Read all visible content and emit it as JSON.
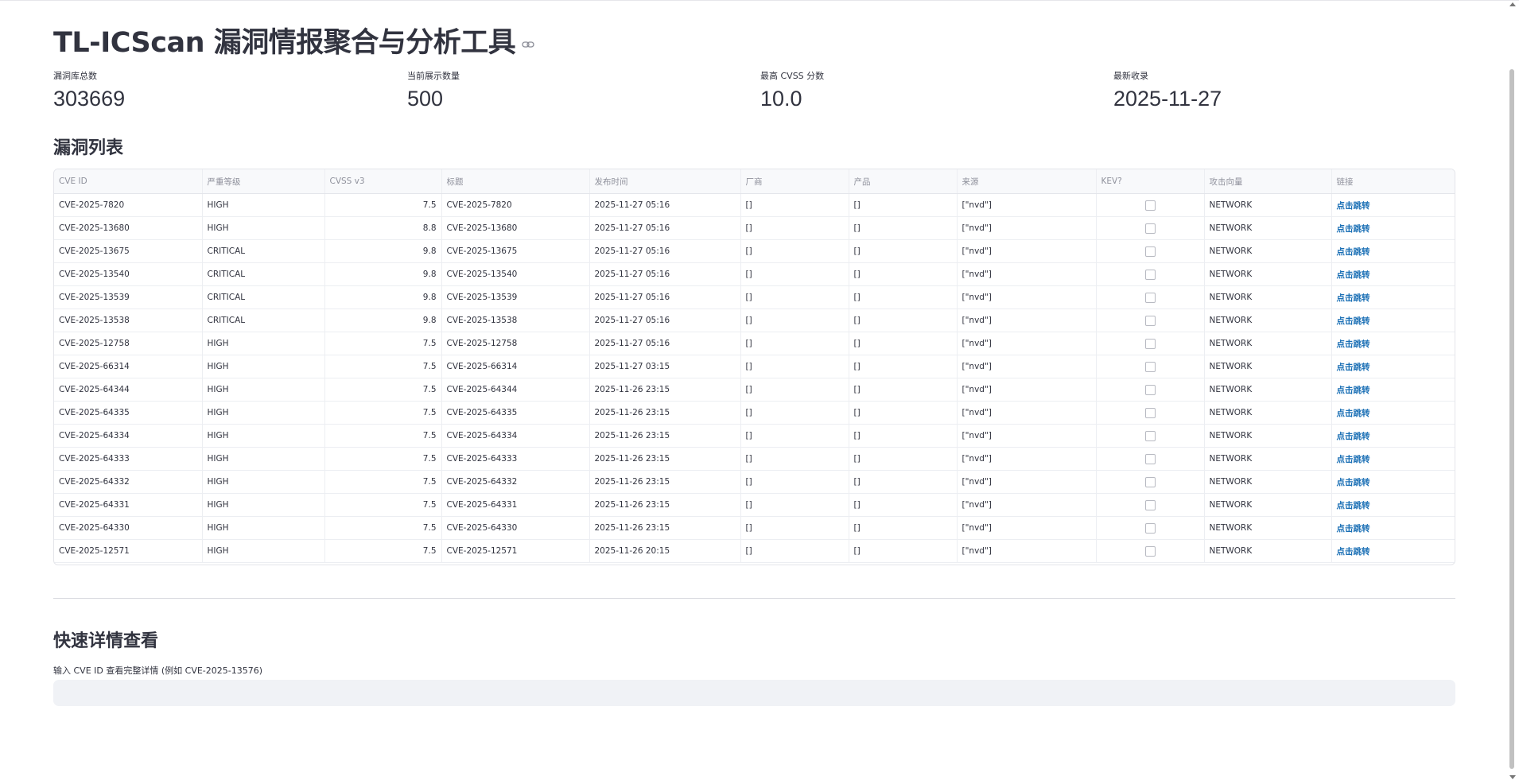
{
  "page": {
    "title": "TL-ICScan 漏洞情报聚合与分析工具"
  },
  "metrics": [
    {
      "label": "漏洞库总数",
      "value": "303669"
    },
    {
      "label": "当前展示数量",
      "value": "500"
    },
    {
      "label": "最高 CVSS 分数",
      "value": "10.0"
    },
    {
      "label": "最新收录",
      "value": "2025-11-27"
    }
  ],
  "vuln_section": {
    "heading": "漏洞列表"
  },
  "table": {
    "columns": [
      "CVE ID",
      "严重等级",
      "CVSS v3",
      "标题",
      "发布时间",
      "厂商",
      "产品",
      "来源",
      "KEV?",
      "攻击向量",
      "链接"
    ],
    "rows": [
      {
        "cve": "CVE-2025-7820",
        "severity": "HIGH",
        "cvss": "7.5",
        "title": "CVE-2025-7820",
        "published": "2025-11-27 05:16",
        "vendor": "[]",
        "product": "[]",
        "source": "[\"nvd\"]",
        "kev": false,
        "vector": "NETWORK",
        "link": "点击跳转"
      },
      {
        "cve": "CVE-2025-13680",
        "severity": "HIGH",
        "cvss": "8.8",
        "title": "CVE-2025-13680",
        "published": "2025-11-27 05:16",
        "vendor": "[]",
        "product": "[]",
        "source": "[\"nvd\"]",
        "kev": false,
        "vector": "NETWORK",
        "link": "点击跳转"
      },
      {
        "cve": "CVE-2025-13675",
        "severity": "CRITICAL",
        "cvss": "9.8",
        "title": "CVE-2025-13675",
        "published": "2025-11-27 05:16",
        "vendor": "[]",
        "product": "[]",
        "source": "[\"nvd\"]",
        "kev": false,
        "vector": "NETWORK",
        "link": "点击跳转"
      },
      {
        "cve": "CVE-2025-13540",
        "severity": "CRITICAL",
        "cvss": "9.8",
        "title": "CVE-2025-13540",
        "published": "2025-11-27 05:16",
        "vendor": "[]",
        "product": "[]",
        "source": "[\"nvd\"]",
        "kev": false,
        "vector": "NETWORK",
        "link": "点击跳转"
      },
      {
        "cve": "CVE-2025-13539",
        "severity": "CRITICAL",
        "cvss": "9.8",
        "title": "CVE-2025-13539",
        "published": "2025-11-27 05:16",
        "vendor": "[]",
        "product": "[]",
        "source": "[\"nvd\"]",
        "kev": false,
        "vector": "NETWORK",
        "link": "点击跳转"
      },
      {
        "cve": "CVE-2025-13538",
        "severity": "CRITICAL",
        "cvss": "9.8",
        "title": "CVE-2025-13538",
        "published": "2025-11-27 05:16",
        "vendor": "[]",
        "product": "[]",
        "source": "[\"nvd\"]",
        "kev": false,
        "vector": "NETWORK",
        "link": "点击跳转"
      },
      {
        "cve": "CVE-2025-12758",
        "severity": "HIGH",
        "cvss": "7.5",
        "title": "CVE-2025-12758",
        "published": "2025-11-27 05:16",
        "vendor": "[]",
        "product": "[]",
        "source": "[\"nvd\"]",
        "kev": false,
        "vector": "NETWORK",
        "link": "点击跳转"
      },
      {
        "cve": "CVE-2025-66314",
        "severity": "HIGH",
        "cvss": "7.5",
        "title": "CVE-2025-66314",
        "published": "2025-11-27 03:15",
        "vendor": "[]",
        "product": "[]",
        "source": "[\"nvd\"]",
        "kev": false,
        "vector": "NETWORK",
        "link": "点击跳转"
      },
      {
        "cve": "CVE-2025-64344",
        "severity": "HIGH",
        "cvss": "7.5",
        "title": "CVE-2025-64344",
        "published": "2025-11-26 23:15",
        "vendor": "[]",
        "product": "[]",
        "source": "[\"nvd\"]",
        "kev": false,
        "vector": "NETWORK",
        "link": "点击跳转"
      },
      {
        "cve": "CVE-2025-64335",
        "severity": "HIGH",
        "cvss": "7.5",
        "title": "CVE-2025-64335",
        "published": "2025-11-26 23:15",
        "vendor": "[]",
        "product": "[]",
        "source": "[\"nvd\"]",
        "kev": false,
        "vector": "NETWORK",
        "link": "点击跳转"
      },
      {
        "cve": "CVE-2025-64334",
        "severity": "HIGH",
        "cvss": "7.5",
        "title": "CVE-2025-64334",
        "published": "2025-11-26 23:15",
        "vendor": "[]",
        "product": "[]",
        "source": "[\"nvd\"]",
        "kev": false,
        "vector": "NETWORK",
        "link": "点击跳转"
      },
      {
        "cve": "CVE-2025-64333",
        "severity": "HIGH",
        "cvss": "7.5",
        "title": "CVE-2025-64333",
        "published": "2025-11-26 23:15",
        "vendor": "[]",
        "product": "[]",
        "source": "[\"nvd\"]",
        "kev": false,
        "vector": "NETWORK",
        "link": "点击跳转"
      },
      {
        "cve": "CVE-2025-64332",
        "severity": "HIGH",
        "cvss": "7.5",
        "title": "CVE-2025-64332",
        "published": "2025-11-26 23:15",
        "vendor": "[]",
        "product": "[]",
        "source": "[\"nvd\"]",
        "kev": false,
        "vector": "NETWORK",
        "link": "点击跳转"
      },
      {
        "cve": "CVE-2025-64331",
        "severity": "HIGH",
        "cvss": "7.5",
        "title": "CVE-2025-64331",
        "published": "2025-11-26 23:15",
        "vendor": "[]",
        "product": "[]",
        "source": "[\"nvd\"]",
        "kev": false,
        "vector": "NETWORK",
        "link": "点击跳转"
      },
      {
        "cve": "CVE-2025-64330",
        "severity": "HIGH",
        "cvss": "7.5",
        "title": "CVE-2025-64330",
        "published": "2025-11-26 23:15",
        "vendor": "[]",
        "product": "[]",
        "source": "[\"nvd\"]",
        "kev": false,
        "vector": "NETWORK",
        "link": "点击跳转"
      },
      {
        "cve": "CVE-2025-12571",
        "severity": "HIGH",
        "cvss": "7.5",
        "title": "CVE-2025-12571",
        "published": "2025-11-26 20:15",
        "vendor": "[]",
        "product": "[]",
        "source": "[\"nvd\"]",
        "kev": false,
        "vector": "NETWORK",
        "link": "点击跳转"
      }
    ]
  },
  "detail_section": {
    "heading": "快速详情查看",
    "input_label": "输入 CVE ID 查看完整详情 (例如 CVE-2025-13576)",
    "input_value": ""
  },
  "colors": {
    "link": "#1a6fb5",
    "input_bg": "#f0f2f6",
    "header_bg": "#f8f9fb"
  },
  "icons": {
    "title_anchor": "link-icon",
    "kev_cell": "checkbox-icon"
  }
}
